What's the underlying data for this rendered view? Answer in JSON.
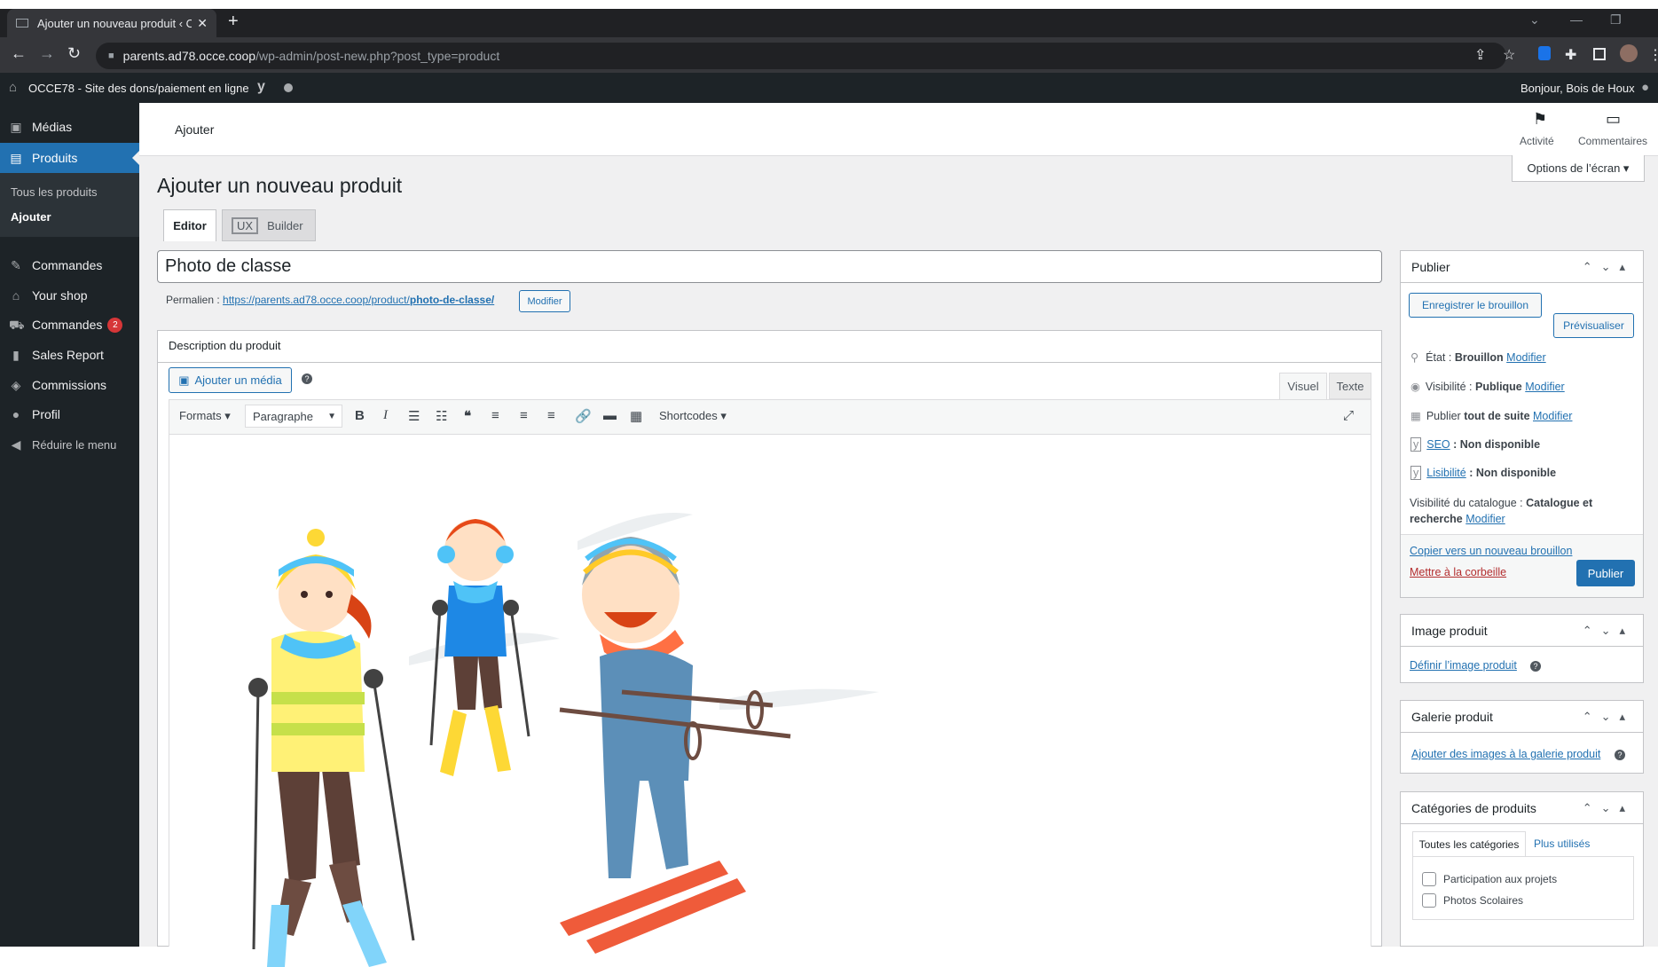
{
  "browser": {
    "tab_title": "Ajouter un nouveau produit ‹ OC",
    "url_host": "parents.ad78.occe.coop",
    "url_path": "/wp-admin/post-new.php?post_type=product"
  },
  "adminbar": {
    "site_name": "OCCE78 - Site des dons/paiement en ligne",
    "greeting": "Bonjour, Bois de Houx"
  },
  "sidebar": {
    "items": [
      {
        "label": "Médias",
        "icon": "media-icon"
      },
      {
        "label": "Produits",
        "icon": "products-icon"
      },
      {
        "label": "Commandes",
        "icon": "pin-icon"
      },
      {
        "label": "Your shop",
        "icon": "store-icon"
      },
      {
        "label": "Commandes",
        "icon": "cart-icon",
        "badge": "2"
      },
      {
        "label": "Sales Report",
        "icon": "chart-icon"
      },
      {
        "label": "Commissions",
        "icon": "commissions-icon"
      },
      {
        "label": "Profil",
        "icon": "user-icon"
      },
      {
        "label": "Réduire le menu",
        "icon": "collapse-icon"
      }
    ],
    "submenu": [
      "Tous les produits",
      "Ajouter"
    ]
  },
  "header": {
    "breadcrumb": "Ajouter",
    "activity": "Activité",
    "comments": "Commentaires",
    "screen_options": "Options de l’écran ▾"
  },
  "main": {
    "page_title": "Ajouter un nouveau produit",
    "tab_editor": "Editor",
    "tab_ux": "UX",
    "tab_builder": "Builder",
    "title_value": "Photo de classe",
    "permalink_label": "Permalien :",
    "permalink_base": "https://parents.ad78.occe.coop/product/",
    "permalink_slug": "photo-de-classe/",
    "permalink_edit": "Modifier",
    "description_label": "Description du produit",
    "add_media": "Ajouter un média",
    "tab_visual": "Visuel",
    "tab_text": "Texte",
    "formats": "Formats ▾",
    "paragraph": "Paragraphe",
    "shortcodes": "Shortcodes ▾"
  },
  "publish": {
    "title": "Publier",
    "save_draft": "Enregistrer le brouillon",
    "preview": "Prévisualiser",
    "status_label": "État :",
    "status_value": "Brouillon",
    "visibility_label": "Visibilité :",
    "visibility_value": "Publique",
    "publish_now_pre": "Publier",
    "publish_now_value": "tout de suite",
    "seo_label": "SEO",
    "seo_value": ": Non disponible",
    "readability_label": "Lisibilité",
    "readability_value": ": Non disponible",
    "catalog_label": "Visibilité du catalogue :",
    "catalog_value_1": "Catalogue et",
    "catalog_value_2": "recherche",
    "modify": "Modifier",
    "copy_draft": "Copier vers un nouveau brouillon",
    "trash": "Mettre à la corbeille",
    "publish_button": "Publier"
  },
  "image_box": {
    "title": "Image produit",
    "link": "Définir l’image produit"
  },
  "gallery_box": {
    "title": "Galerie produit",
    "link": "Ajouter des images à la galerie produit"
  },
  "categories_box": {
    "title": "Catégories de produits",
    "tab_all": "Toutes les catégories",
    "tab_most": "Plus utilisés",
    "items": [
      "Participation aux projets",
      "Photos Scolaires"
    ]
  },
  "colors": {
    "admin_dark": "#1d2327",
    "accent": "#2271b1",
    "trash": "#b32d2e",
    "badge": "#d63638"
  }
}
